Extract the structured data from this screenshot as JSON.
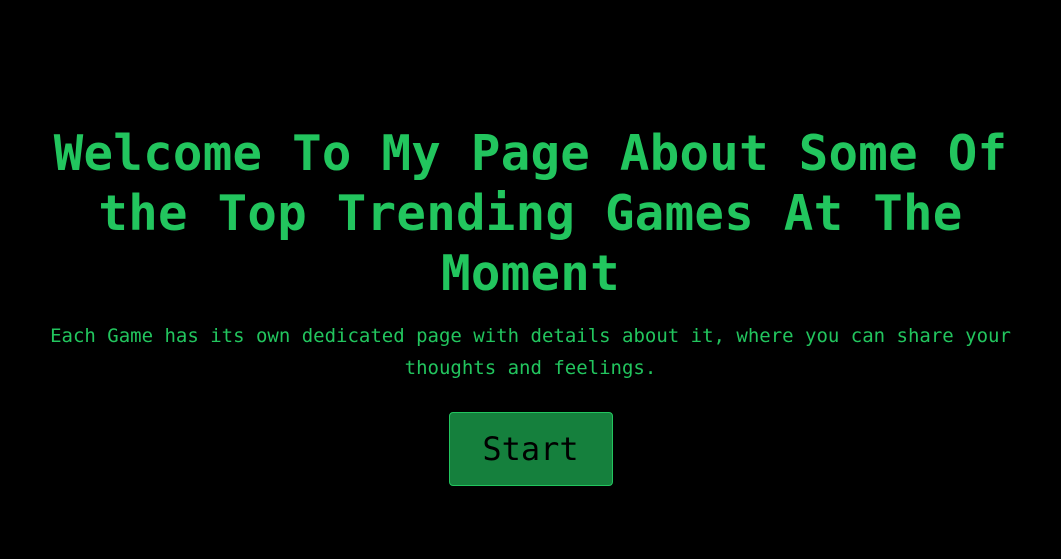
{
  "hero": {
    "title": "Welcome To My Page About Some Of the Top Trending Games At The Moment",
    "subtitle": "Each Game has its own dedicated page with details about it, where you can share your thoughts and feelings.",
    "start_label": "Start"
  },
  "colors": {
    "background": "#000000",
    "accent_text": "#22c55e",
    "button_bg": "#15803d",
    "button_text": "#000000"
  }
}
